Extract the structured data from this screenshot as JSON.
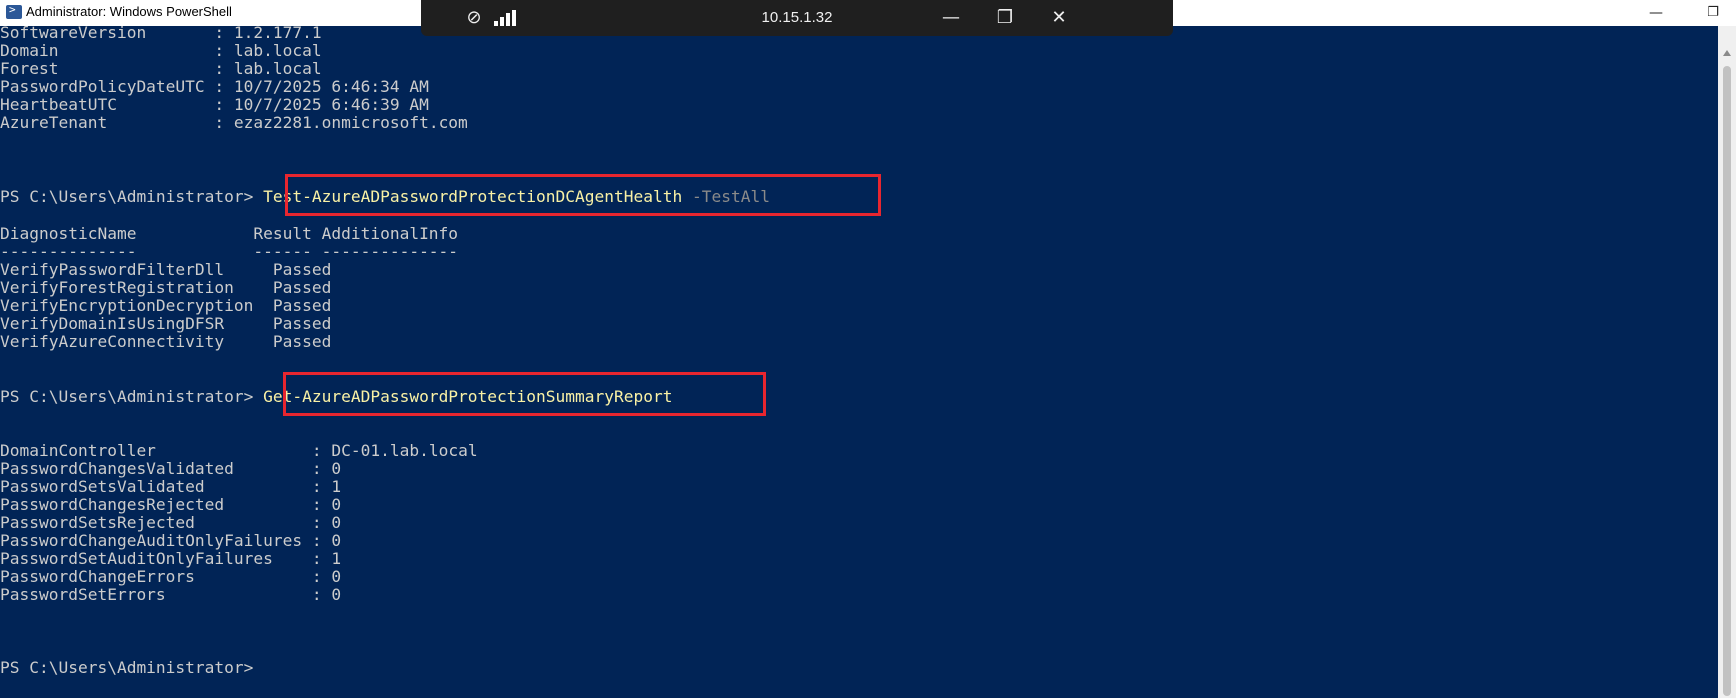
{
  "window": {
    "title": "Administrator: Windows PowerShell",
    "minimize": "—",
    "maximize": "❐",
    "close": "✕"
  },
  "rdp_bar": {
    "address": "10.15.1.32",
    "pin_icon": "⊘",
    "minimize": "—",
    "restore": "❐",
    "close": "✕"
  },
  "console": {
    "status": [
      {
        "key": "SoftwareVersion       ",
        "value": "1.2.177.1"
      },
      {
        "key": "Domain                ",
        "value": "lab.local"
      },
      {
        "key": "Forest                ",
        "value": "lab.local"
      },
      {
        "key": "PasswordPolicyDateUTC ",
        "value": "10/7/2025 6:46:34 AM"
      },
      {
        "key": "HeartbeatUTC          ",
        "value": "10/7/2025 6:46:39 AM"
      },
      {
        "key": "AzureTenant           ",
        "value": "ezaz2281.onmicrosoft.com"
      }
    ],
    "prompt": "PS C:\\Users\\Administrator>",
    "command1": "Test-AzureADPasswordProtectionDCAgentHealth",
    "command1_param": "-TestAll",
    "diag_header": "DiagnosticName            Result AdditionalInfo",
    "diag_sep": "--------------            ------ --------------",
    "diag_rows": [
      {
        "name": "VerifyPasswordFilterDll   ",
        "result": "Passed"
      },
      {
        "name": "VerifyForestRegistration  ",
        "result": "Passed"
      },
      {
        "name": "VerifyEncryptionDecryption",
        "result": "Passed"
      },
      {
        "name": "VerifyDomainIsUsingDFSR   ",
        "result": "Passed"
      },
      {
        "name": "VerifyAzureConnectivity   ",
        "result": "Passed"
      }
    ],
    "command2": "Get-AzureADPasswordProtectionSummaryReport",
    "summary": [
      {
        "key": "DomainController               ",
        "value": "DC-01.lab.local"
      },
      {
        "key": "PasswordChangesValidated       ",
        "value": "0"
      },
      {
        "key": "PasswordSetsValidated          ",
        "value": "1"
      },
      {
        "key": "PasswordChangesRejected        ",
        "value": "0"
      },
      {
        "key": "PasswordSetsRejected           ",
        "value": "0"
      },
      {
        "key": "PasswordChangeAuditOnlyFailures",
        "value": "0"
      },
      {
        "key": "PasswordSetAuditOnlyFailures   ",
        "value": "1"
      },
      {
        "key": "PasswordChangeErrors           ",
        "value": "0"
      },
      {
        "key": "PasswordSetErrors              ",
        "value": "0"
      }
    ]
  },
  "colors": {
    "background": "#012456",
    "text": "#cccccc",
    "command": "#f9f1a5",
    "parameter": "#8a8a8a",
    "highlight_box": "#e8262f"
  }
}
